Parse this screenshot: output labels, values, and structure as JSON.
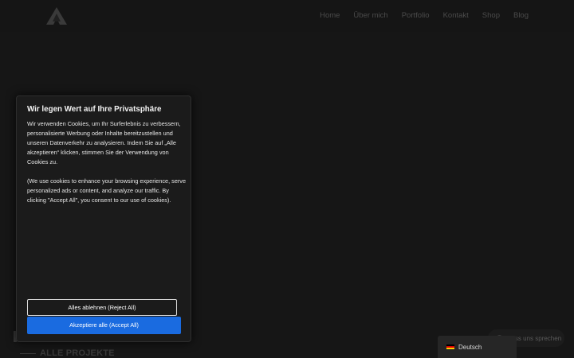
{
  "header": {
    "nav": [
      "Home",
      "Über mich",
      "Portfolio",
      "Kontakt",
      "Shop",
      "Blog"
    ]
  },
  "section": {
    "title": "ALLE PROJEKTE"
  },
  "cookie_banner": {
    "title": "Wir legen Wert auf Ihre Privatsphäre",
    "text_de": "Wir verwenden Cookies, um Ihr Surferlebnis zu verbessern, personalisierte Werbung oder Inhalte bereitzustellen und unseren Datenverkehr zu analysieren. Indem Sie auf „Alle akzeptieren“ klicken, stimmen Sie der Verwendung von Cookies zu.",
    "text_en": "(We use cookies to enhance your browsing experience, serve personalized ads or content, and analyze our traffic. By clicking \"Accept All\", you consent to our use of cookies).",
    "reject_label": "Alles ablehnen (Reject All)",
    "accept_label": "Akzeptiere alle (Accept All)"
  },
  "chat_widget": {
    "label": "Lass uns sprechen"
  },
  "language": {
    "label": "Deutsch",
    "flag_icon": "germany-flag-icon"
  },
  "colors": {
    "accent": "#1a6be0",
    "background": "#141414"
  }
}
